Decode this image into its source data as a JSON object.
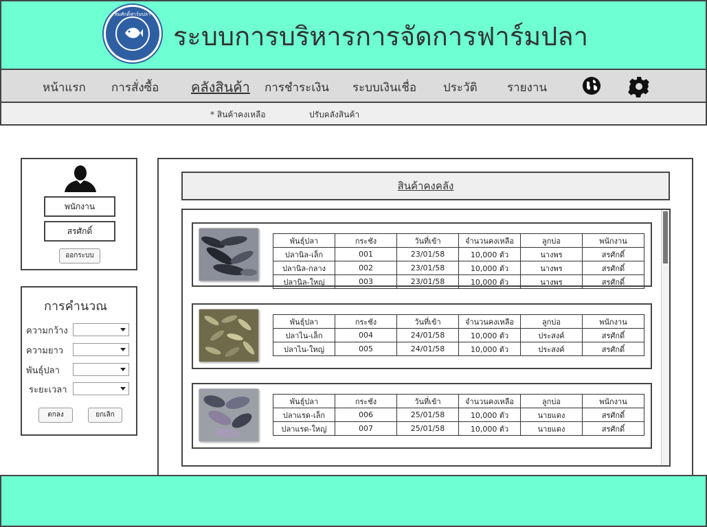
{
  "header": {
    "title": "ระบบการบริหารการจัดการฟาร์มปลา",
    "logo_text": "สมศักดิ์ฟาร์มปลา",
    "bg_color": "#6effd2"
  },
  "nav": {
    "items": [
      {
        "label": "หน้าแรก"
      },
      {
        "label": "การสั่งซื้อ"
      },
      {
        "label": "คลังสินค้า",
        "active": true
      },
      {
        "label": "การชำระเงิน"
      },
      {
        "label": "ระบบเงินเชื่อ"
      },
      {
        "label": "ประวัติ"
      },
      {
        "label": "รายงาน"
      }
    ],
    "icons": [
      "globe-icon",
      "gear-icon"
    ]
  },
  "subnav": {
    "items": [
      {
        "label": "* สินค้าคงเหลือ"
      },
      {
        "label": "ปรับคลังสินค้า"
      }
    ]
  },
  "user": {
    "role": "พนักงาน",
    "name": "สรศักดิ์",
    "logout_label": "ออกระบบ"
  },
  "calc": {
    "title": "การคำนวณ",
    "fields": [
      {
        "label": "ความกว้าง",
        "value": ""
      },
      {
        "label": "ความยาว",
        "value": ""
      },
      {
        "label": "พันธุ์ปลา",
        "value": ""
      },
      {
        "label": "ระยะเวลา",
        "value": ""
      }
    ],
    "ok_label": "ตกลง",
    "cancel_label": "ยกเลิก"
  },
  "stock": {
    "title": "สินค้าคงคลัง",
    "columns": [
      "พันธุ์ปลา",
      "กระชัง",
      "วันที่เข้า",
      "จำนวนคงเหลือ",
      "ลูกบ่อ",
      "พนักงาน"
    ],
    "groups": [
      {
        "rows": [
          [
            "ปลานิล-เล็ก",
            "001",
            "23/01/58",
            "10,000 ตัว",
            "นางพร",
            "สรศักดิ์"
          ],
          [
            "ปลานิล-กลาง",
            "002",
            "23/01/58",
            "10,000 ตัว",
            "นางพร",
            "สรศักดิ์"
          ],
          [
            "ปลานิล-ใหญ่",
            "003",
            "23/01/58",
            "10,000 ตัว",
            "นางพร",
            "สรศักดิ์"
          ]
        ]
      },
      {
        "rows": [
          [
            "ปลาไน-เล็ก",
            "004",
            "24/01/58",
            "10,000 ตัว",
            "ประสงค์",
            "สรศักดิ์"
          ],
          [
            "ปลาไน-ใหญ่",
            "005",
            "24/01/58",
            "10,000 ตัว",
            "ประสงค์",
            "สรศักดิ์"
          ]
        ]
      },
      {
        "rows": [
          [
            "ปลาแรด-เล็ก",
            "006",
            "25/01/58",
            "10,000 ตัว",
            "นายแดง",
            "สรศักดิ์"
          ],
          [
            "ปลาแรด-ใหญ่",
            "007",
            "25/01/58",
            "10,000 ตัว",
            "นายแดง",
            "สรศักดิ์"
          ]
        ]
      }
    ]
  }
}
